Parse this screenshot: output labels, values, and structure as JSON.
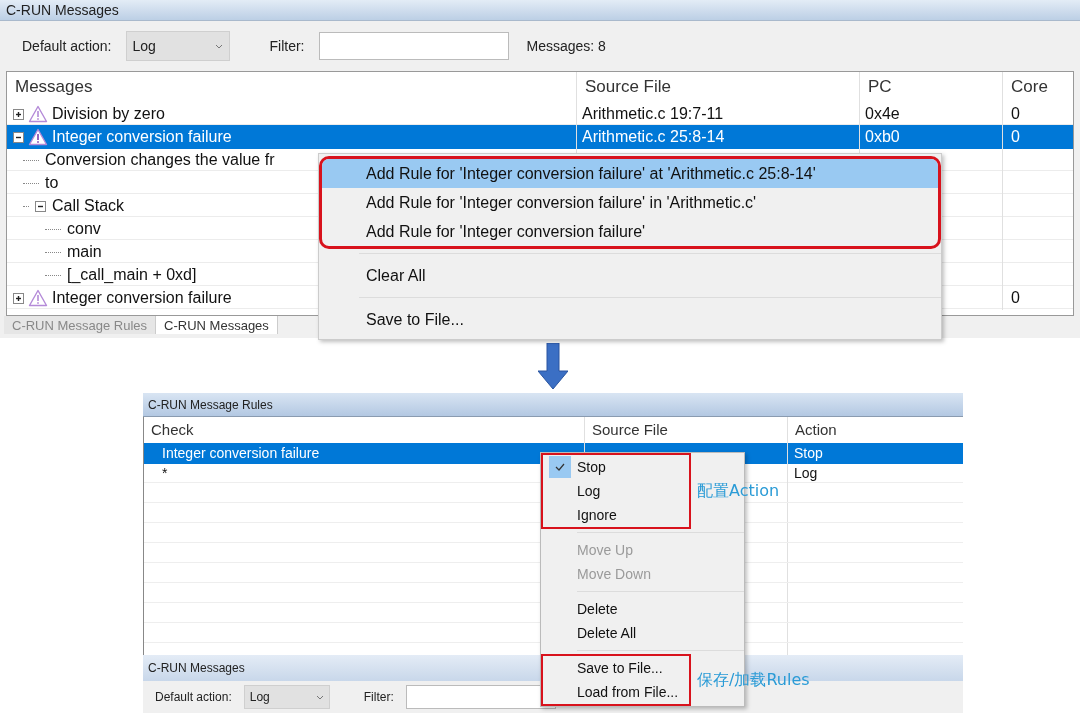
{
  "top_window": {
    "title": "C-RUN Messages",
    "toolbar": {
      "default_action_label": "Default action:",
      "default_action": "Log",
      "filter_label": "Filter:",
      "message_count": "Messages: 8"
    },
    "columns": [
      "Messages",
      "Source File",
      "PC",
      "Core"
    ],
    "rows": [
      {
        "message": "Division by zero",
        "expanded": false,
        "selected": false,
        "source_file": "Arithmetic.c 19:7-11",
        "pc": "0x4e",
        "core": "0"
      },
      {
        "message": "Integer conversion failure",
        "expanded": true,
        "selected": true,
        "source_file": "Arithmetic.c 25:8-14",
        "pc": "0xb0",
        "core": "0",
        "children": [
          {
            "message": "Conversion changes the value fr"
          },
          {
            "message": "to"
          },
          {
            "message": "Call Stack",
            "expanded": true,
            "children": [
              {
                "message": "conv"
              },
              {
                "message": "main"
              },
              {
                "message": "[_call_main + 0xd]"
              }
            ]
          }
        ]
      },
      {
        "message": "Integer conversion failure",
        "expanded": false,
        "selected": false,
        "core": "0"
      }
    ],
    "context_menu": {
      "groups": [
        {
          "outlined": true,
          "items": [
            {
              "label": "Add Rule for 'Integer conversion failure' at 'Arithmetic.c 25:8-14'",
              "selected": true
            },
            {
              "label": "Add Rule for 'Integer conversion failure' in 'Arithmetic.c'",
              "selected": false
            },
            {
              "label": "Add Rule for 'Integer conversion failure'",
              "selected": false
            }
          ]
        },
        {
          "outlined": false,
          "items": [
            {
              "label": "Clear All",
              "selected": false
            }
          ]
        },
        {
          "outlined": false,
          "items": [
            {
              "label": "Save to File...",
              "selected": false
            }
          ]
        }
      ]
    },
    "tabs": [
      {
        "label": "C-RUN Message Rules",
        "selected": false
      },
      {
        "label": "C-RUN Messages",
        "selected": true
      }
    ]
  },
  "bottom_window": {
    "title": "C-RUN Message Rules",
    "columns": [
      "Check",
      "Source File",
      "Action"
    ],
    "rows": [
      {
        "check": "Integer conversion failure",
        "action": "Stop",
        "selected": true
      },
      {
        "check": "*",
        "action": "Log",
        "selected": false
      }
    ],
    "context_menu": {
      "groups": [
        {
          "outlined": true,
          "note": "配置Action",
          "items": [
            {
              "label": "Stop",
              "checked": true,
              "disabled": false
            },
            {
              "label": "Log",
              "checked": false,
              "disabled": false
            },
            {
              "label": "Ignore",
              "checked": false,
              "disabled": false
            }
          ]
        },
        {
          "outlined": false,
          "items": [
            {
              "label": "Move Up",
              "checked": false,
              "disabled": true
            },
            {
              "label": "Move Down",
              "checked": false,
              "disabled": true
            }
          ]
        },
        {
          "outlined": false,
          "items": [
            {
              "label": "Delete",
              "checked": false,
              "disabled": false
            },
            {
              "label": "Delete All",
              "checked": false,
              "disabled": false
            }
          ]
        },
        {
          "outlined": true,
          "note": "保存/加载Rules",
          "items": [
            {
              "label": "Save to File...",
              "checked": false,
              "disabled": false
            },
            {
              "label": "Load from File...",
              "checked": false,
              "disabled": false
            }
          ]
        }
      ]
    },
    "messages_panel": {
      "title": "C-RUN Messages",
      "default_action_label": "Default action:",
      "default_action": "Log",
      "filter_label": "Filter:"
    }
  }
}
